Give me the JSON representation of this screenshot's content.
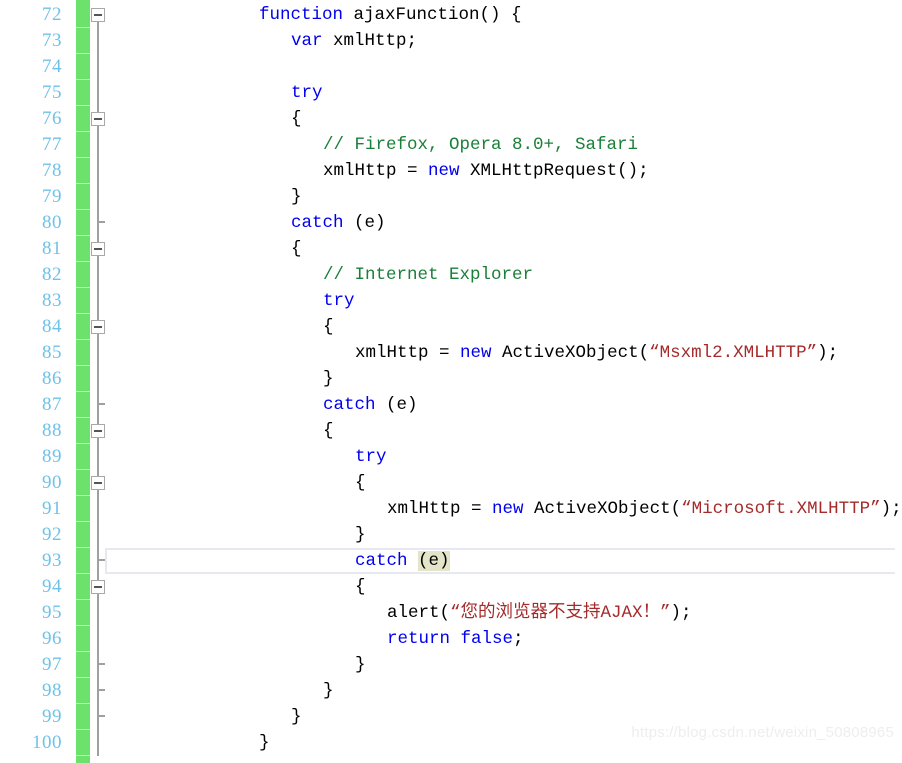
{
  "editor": {
    "first_line": 72,
    "last_line": 100,
    "line_height": 26,
    "active_line": 93,
    "colors": {
      "background": "#ffffff",
      "line_number": "#6fc2e8",
      "keyword": "#0000ee",
      "comment": "#1a7f37",
      "string": "#a52a2a",
      "text": "#000000",
      "change_bar": "#6ce26c",
      "fold_marker": "#a0a0a0",
      "active_line_border": "#e6e8f2",
      "bracket_match_bg": "#e4e4c8",
      "watermark": "#eeeeee"
    },
    "language": "javascript"
  },
  "watermark": {
    "text": "https://blog.csdn.net/weixin_50808965"
  },
  "lines": [
    {
      "n": 72,
      "indent": 3,
      "fold": "minus",
      "tokens": [
        {
          "t": "function",
          "c": "kw"
        },
        {
          "t": " ajaxFunction() {",
          "c": "plain"
        }
      ]
    },
    {
      "n": 73,
      "indent": 4,
      "fold": "line",
      "tokens": [
        {
          "t": "var",
          "c": "kw"
        },
        {
          "t": " xmlHttp;",
          "c": "plain"
        }
      ]
    },
    {
      "n": 74,
      "indent": 0,
      "fold": "line",
      "tokens": []
    },
    {
      "n": 75,
      "indent": 4,
      "fold": "line",
      "tokens": [
        {
          "t": "try",
          "c": "kw"
        }
      ]
    },
    {
      "n": 76,
      "indent": 4,
      "fold": "minus",
      "tokens": [
        {
          "t": "{",
          "c": "plain"
        }
      ]
    },
    {
      "n": 77,
      "indent": 5,
      "fold": "line",
      "tokens": [
        {
          "t": "// Firefox, Opera 8.0+, Safari",
          "c": "cmt"
        }
      ]
    },
    {
      "n": 78,
      "indent": 5,
      "fold": "line",
      "tokens": [
        {
          "t": "xmlHttp = ",
          "c": "plain"
        },
        {
          "t": "new",
          "c": "kw"
        },
        {
          "t": " XMLHttpRequest();",
          "c": "plain"
        }
      ]
    },
    {
      "n": 79,
      "indent": 4,
      "fold": "line",
      "tokens": [
        {
          "t": "}",
          "c": "plain"
        }
      ]
    },
    {
      "n": 80,
      "indent": 4,
      "fold": "tick",
      "tokens": [
        {
          "t": "catch",
          "c": "kw"
        },
        {
          "t": " (e)",
          "c": "plain"
        }
      ]
    },
    {
      "n": 81,
      "indent": 4,
      "fold": "minus",
      "tokens": [
        {
          "t": "{",
          "c": "plain"
        }
      ]
    },
    {
      "n": 82,
      "indent": 5,
      "fold": "line",
      "tokens": [
        {
          "t": "// Internet Explorer",
          "c": "cmt"
        }
      ]
    },
    {
      "n": 83,
      "indent": 5,
      "fold": "line",
      "tokens": [
        {
          "t": "try",
          "c": "kw"
        }
      ]
    },
    {
      "n": 84,
      "indent": 5,
      "fold": "minus",
      "tokens": [
        {
          "t": "{",
          "c": "plain"
        }
      ]
    },
    {
      "n": 85,
      "indent": 6,
      "fold": "line",
      "tokens": [
        {
          "t": "xmlHttp = ",
          "c": "plain"
        },
        {
          "t": "new",
          "c": "kw"
        },
        {
          "t": " ActiveXObject(",
          "c": "plain"
        },
        {
          "t": "“Msxml2.XMLHTTP”",
          "c": "str"
        },
        {
          "t": ");",
          "c": "plain"
        }
      ]
    },
    {
      "n": 86,
      "indent": 5,
      "fold": "line",
      "tokens": [
        {
          "t": "}",
          "c": "plain"
        }
      ]
    },
    {
      "n": 87,
      "indent": 5,
      "fold": "tick",
      "tokens": [
        {
          "t": "catch",
          "c": "kw"
        },
        {
          "t": " (e)",
          "c": "plain"
        }
      ]
    },
    {
      "n": 88,
      "indent": 5,
      "fold": "minus",
      "tokens": [
        {
          "t": "{",
          "c": "plain"
        }
      ]
    },
    {
      "n": 89,
      "indent": 6,
      "fold": "line",
      "tokens": [
        {
          "t": "try",
          "c": "kw"
        }
      ]
    },
    {
      "n": 90,
      "indent": 6,
      "fold": "minus",
      "tokens": [
        {
          "t": "{",
          "c": "plain"
        }
      ]
    },
    {
      "n": 91,
      "indent": 7,
      "fold": "line",
      "tokens": [
        {
          "t": "xmlHttp = ",
          "c": "plain"
        },
        {
          "t": "new",
          "c": "kw"
        },
        {
          "t": " ActiveXObject(",
          "c": "plain"
        },
        {
          "t": "“Microsoft.XMLHTTP”",
          "c": "str"
        },
        {
          "t": ");",
          "c": "plain"
        }
      ]
    },
    {
      "n": 92,
      "indent": 6,
      "fold": "line",
      "tokens": [
        {
          "t": "}",
          "c": "plain"
        }
      ]
    },
    {
      "n": 93,
      "indent": 6,
      "fold": "tick",
      "active": true,
      "tokens": [
        {
          "t": "catch",
          "c": "kw"
        },
        {
          "t": " ",
          "c": "plain"
        },
        {
          "t": "(e)",
          "c": "match-br"
        }
      ]
    },
    {
      "n": 94,
      "indent": 6,
      "fold": "minus",
      "tokens": [
        {
          "t": "{",
          "c": "plain"
        }
      ]
    },
    {
      "n": 95,
      "indent": 7,
      "fold": "line",
      "tokens": [
        {
          "t": "alert(",
          "c": "plain"
        },
        {
          "t": "“您的浏览器不支持AJAX！”",
          "c": "str"
        },
        {
          "t": ");",
          "c": "plain"
        }
      ]
    },
    {
      "n": 96,
      "indent": 7,
      "fold": "line",
      "tokens": [
        {
          "t": "return",
          "c": "kw"
        },
        {
          "t": " ",
          "c": "plain"
        },
        {
          "t": "false",
          "c": "kw"
        },
        {
          "t": ";",
          "c": "plain"
        }
      ]
    },
    {
      "n": 97,
      "indent": 6,
      "fold": "tick",
      "tokens": [
        {
          "t": "}",
          "c": "plain"
        }
      ]
    },
    {
      "n": 98,
      "indent": 5,
      "fold": "tick",
      "tokens": [
        {
          "t": "}",
          "c": "plain"
        }
      ]
    },
    {
      "n": 99,
      "indent": 4,
      "fold": "tick",
      "tokens": [
        {
          "t": "}",
          "c": "plain"
        }
      ]
    },
    {
      "n": 100,
      "indent": 3,
      "fold": "line",
      "tokens": [
        {
          "t": "}",
          "c": "plain"
        }
      ]
    }
  ]
}
